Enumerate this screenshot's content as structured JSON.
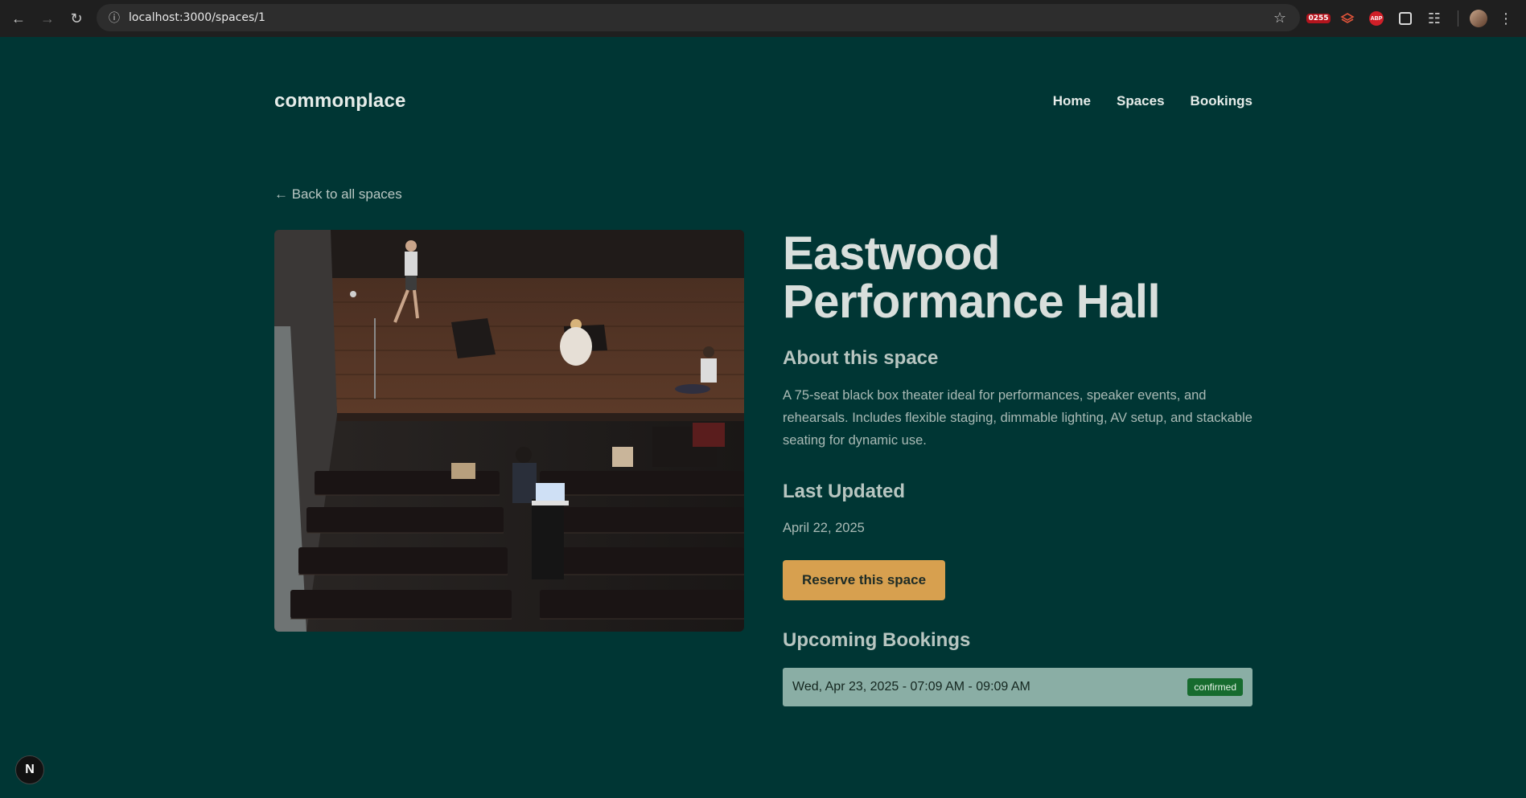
{
  "browser": {
    "url": "localhost:3000/spaces/1",
    "ext_badge_text": "0255",
    "ext_abp_text": "ABP"
  },
  "header": {
    "logo": "commonplace",
    "nav": [
      "Home",
      "Spaces",
      "Bookings"
    ]
  },
  "back_link": "← Back to all spaces",
  "space": {
    "title_line1": "Eastwood",
    "title_line2": "Performance Hall",
    "about_heading": "About this space",
    "description": "A 75-seat black box theater ideal for performances, speaker events, and rehearsals. Includes flexible staging, dimmable lighting, AV setup, and stackable seating for dynamic use.",
    "updated_heading": "Last Updated",
    "updated_date": "April 22, 2025",
    "reserve_label": "Reserve this space",
    "upcoming_heading": "Upcoming Bookings",
    "bookings": [
      {
        "time": "Wed, Apr 23, 2025 - 07:09 AM - 09:09 AM",
        "status": "confirmed"
      }
    ]
  },
  "dev_badge": "N",
  "colors": {
    "background": "#003634",
    "accent": "#d7a04f",
    "booking_row": "#8aaea5",
    "status_confirmed": "#166b2e"
  }
}
